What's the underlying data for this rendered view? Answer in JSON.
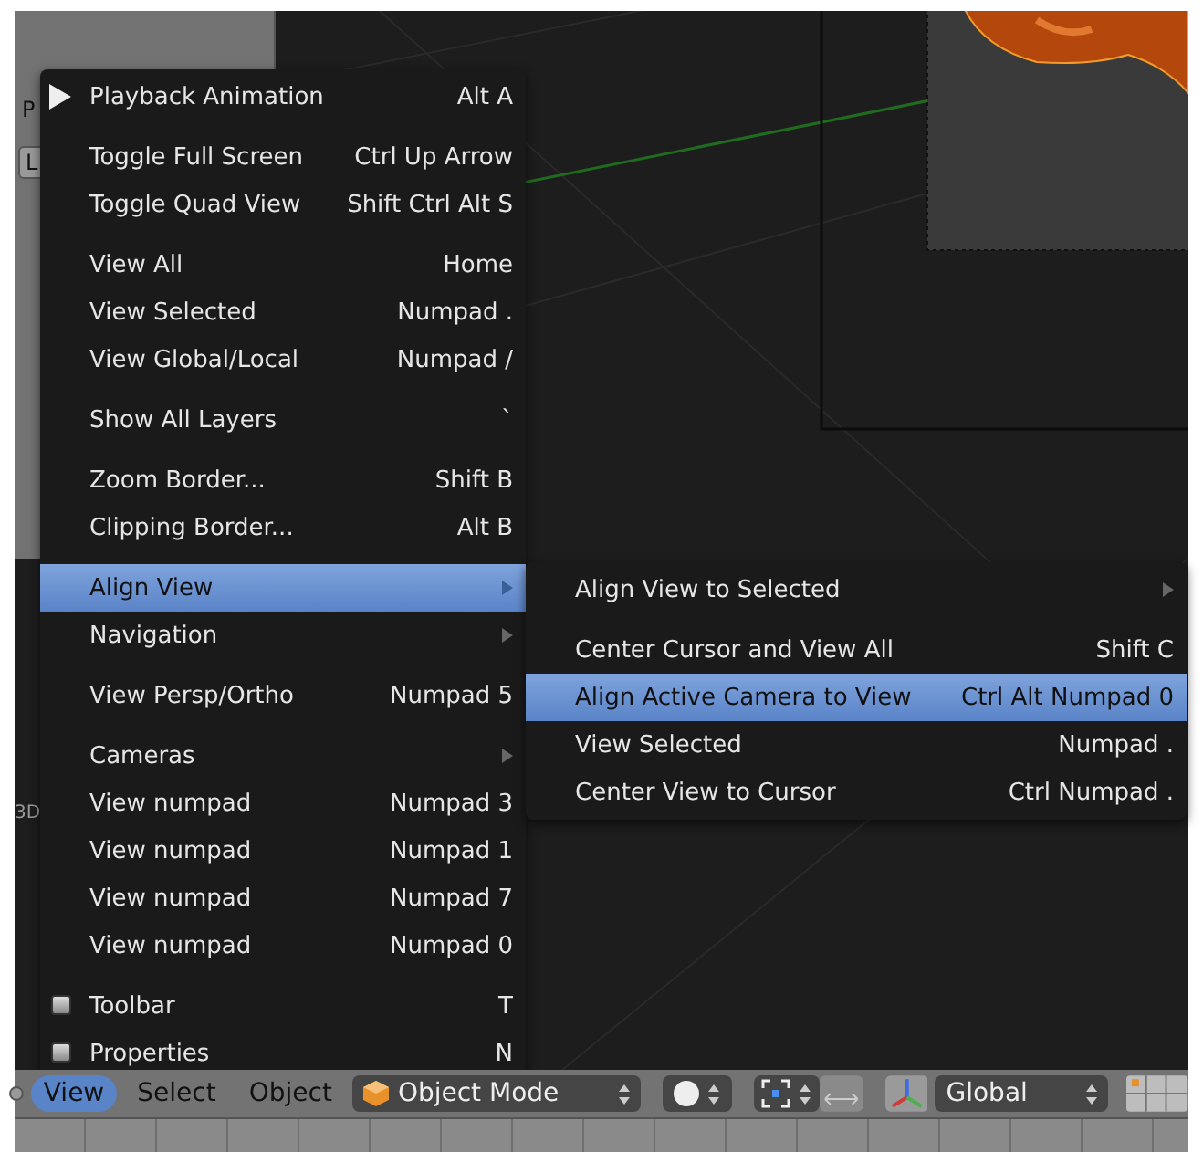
{
  "side_panel": {
    "labels": [
      "P",
      "L"
    ],
    "cursor_label": "3D"
  },
  "view_menu": {
    "groups": [
      [
        {
          "label": "Playback Animation",
          "shortcut": "Alt A",
          "kind": "play",
          "submenu": false,
          "selected": false
        }
      ],
      [
        {
          "label": "Toggle Full Screen",
          "shortcut": "Ctrl Up Arrow",
          "kind": "item",
          "submenu": false,
          "selected": false
        },
        {
          "label": "Toggle Quad View",
          "shortcut": "Shift Ctrl Alt S",
          "kind": "item",
          "submenu": false,
          "selected": false
        }
      ],
      [
        {
          "label": "View All",
          "shortcut": "Home",
          "kind": "item",
          "submenu": false,
          "selected": false
        },
        {
          "label": "View Selected",
          "shortcut": "Numpad .",
          "kind": "item",
          "submenu": false,
          "selected": false
        },
        {
          "label": "View Global/Local",
          "shortcut": "Numpad /",
          "kind": "item",
          "submenu": false,
          "selected": false
        }
      ],
      [
        {
          "label": "Show All Layers",
          "shortcut": "`",
          "kind": "item",
          "submenu": false,
          "selected": false
        }
      ],
      [
        {
          "label": "Zoom Border...",
          "shortcut": "Shift B",
          "kind": "item",
          "submenu": false,
          "selected": false
        },
        {
          "label": "Clipping Border...",
          "shortcut": "Alt B",
          "kind": "item",
          "submenu": false,
          "selected": false
        }
      ],
      [
        {
          "label": "Align View",
          "kind": "item",
          "submenu": true,
          "selected": true
        },
        {
          "label": "Navigation",
          "kind": "item",
          "submenu": true,
          "selected": false
        }
      ],
      [
        {
          "label": "View Persp/Ortho",
          "shortcut": "Numpad 5",
          "kind": "item",
          "submenu": false,
          "selected": false
        }
      ],
      [
        {
          "label": "Cameras",
          "kind": "item",
          "submenu": true,
          "selected": false
        },
        {
          "label": "View numpad",
          "shortcut": "Numpad 3",
          "kind": "item",
          "submenu": false,
          "selected": false
        },
        {
          "label": "View numpad",
          "shortcut": "Numpad 1",
          "kind": "item",
          "submenu": false,
          "selected": false
        },
        {
          "label": "View numpad",
          "shortcut": "Numpad 7",
          "kind": "item",
          "submenu": false,
          "selected": false
        },
        {
          "label": "View numpad",
          "shortcut": "Numpad 0",
          "kind": "item",
          "submenu": false,
          "selected": false
        }
      ],
      [
        {
          "label": "Toolbar",
          "shortcut": "T",
          "kind": "checkbox",
          "checked": false,
          "submenu": false,
          "selected": false
        },
        {
          "label": "Properties",
          "shortcut": "N",
          "kind": "checkbox",
          "checked": false,
          "submenu": false,
          "selected": false
        }
      ]
    ]
  },
  "align_view_submenu": {
    "groups": [
      [
        {
          "label": "Align View to Selected",
          "kind": "item",
          "submenu": true,
          "selected": false
        }
      ],
      [
        {
          "label": "Center Cursor and View All",
          "shortcut": "Shift C",
          "kind": "item",
          "submenu": false,
          "selected": false
        },
        {
          "label": "Align Active Camera to View",
          "shortcut": "Ctrl Alt Numpad 0",
          "kind": "item",
          "submenu": false,
          "selected": true
        },
        {
          "label": "View Selected",
          "shortcut": "Numpad .",
          "kind": "item",
          "submenu": false,
          "selected": false
        },
        {
          "label": "Center View to Cursor",
          "shortcut": "Ctrl Numpad .",
          "kind": "item",
          "submenu": false,
          "selected": false
        }
      ]
    ]
  },
  "header": {
    "menus": [
      {
        "label": "View",
        "selected": true
      },
      {
        "label": "Select",
        "selected": false
      },
      {
        "label": "Object",
        "selected": false
      }
    ],
    "mode": "Object Mode",
    "orientation": "Global"
  }
}
